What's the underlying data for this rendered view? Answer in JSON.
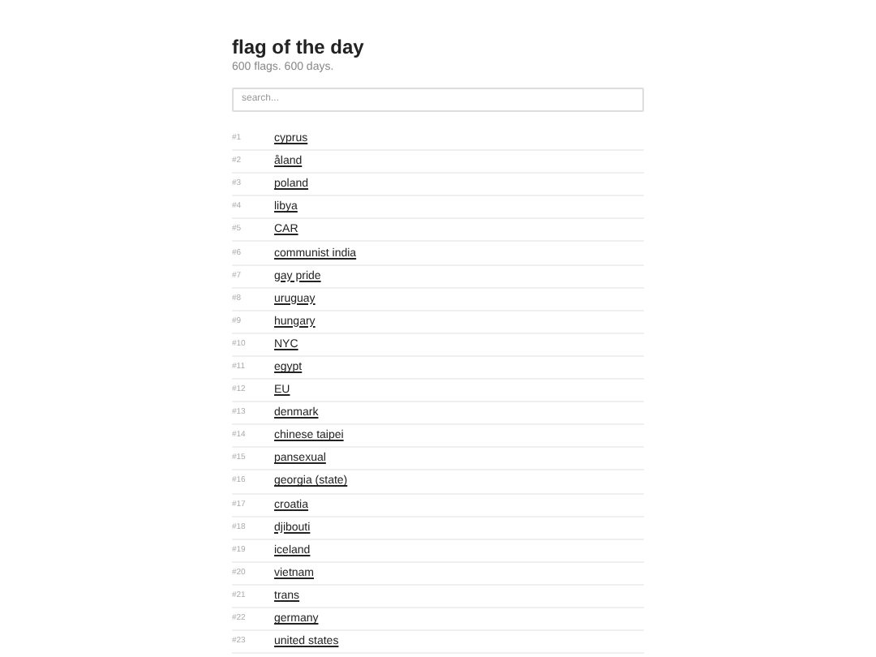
{
  "title": "flag of the day",
  "subtitle": "600 flags. 600 days.",
  "search": {
    "placeholder": "search..."
  },
  "flags": [
    {
      "number": "#1",
      "name": "cyprus"
    },
    {
      "number": "#2",
      "name": "åland"
    },
    {
      "number": "#3",
      "name": "poland"
    },
    {
      "number": "#4",
      "name": "libya"
    },
    {
      "number": "#5",
      "name": "CAR"
    },
    {
      "number": "#6",
      "name": "communist india"
    },
    {
      "number": "#7",
      "name": "gay pride"
    },
    {
      "number": "#8",
      "name": "uruguay"
    },
    {
      "number": "#9",
      "name": "hungary"
    },
    {
      "number": "#10",
      "name": "NYC"
    },
    {
      "number": "#11",
      "name": "egypt"
    },
    {
      "number": "#12",
      "name": "EU"
    },
    {
      "number": "#13",
      "name": "denmark"
    },
    {
      "number": "#14",
      "name": "chinese taipei"
    },
    {
      "number": "#15",
      "name": "pansexual"
    },
    {
      "number": "#16",
      "name": "georgia (state)"
    },
    {
      "number": "#17",
      "name": "croatia"
    },
    {
      "number": "#18",
      "name": "djibouti"
    },
    {
      "number": "#19",
      "name": "iceland"
    },
    {
      "number": "#20",
      "name": "vietnam"
    },
    {
      "number": "#21",
      "name": "trans"
    },
    {
      "number": "#22",
      "name": "germany"
    },
    {
      "number": "#23",
      "name": "united states"
    }
  ]
}
